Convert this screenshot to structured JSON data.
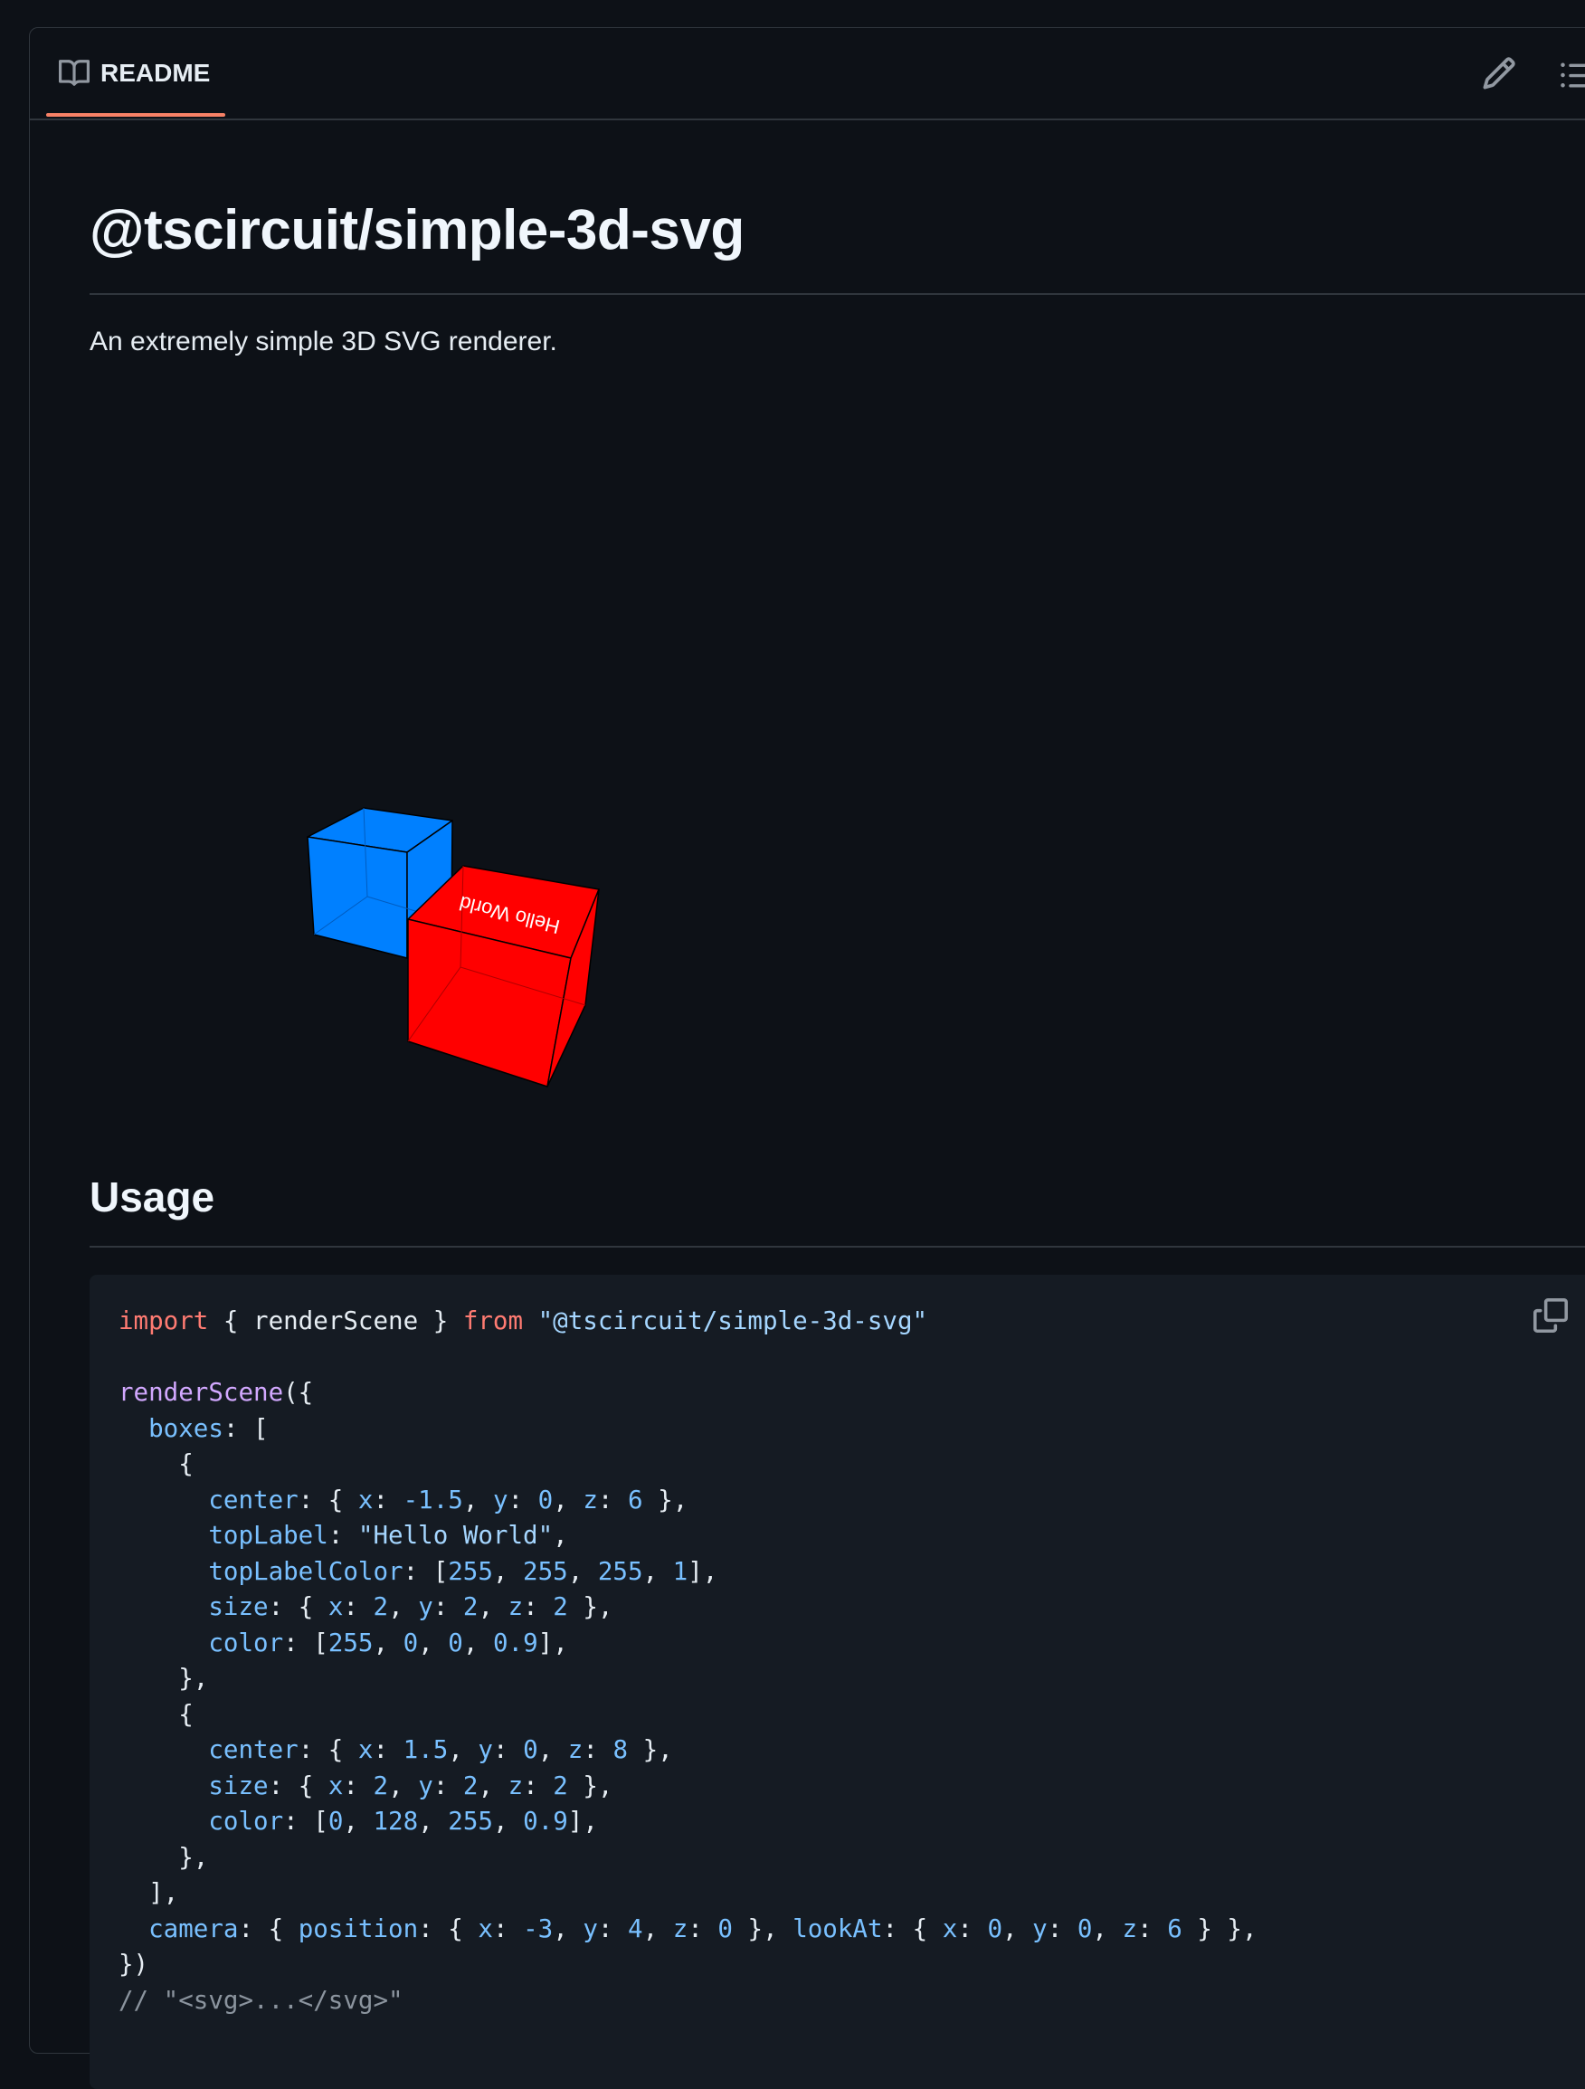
{
  "tab": {
    "label": "README",
    "icon": "book-icon"
  },
  "toolbar": {
    "edit_icon": "pencil-icon",
    "outline_icon": "list-icon",
    "copy_icon": "copy-icon"
  },
  "readme": {
    "title": "@tscircuit/simple-3d-svg",
    "description": "An extremely simple 3D SVG renderer.",
    "usage_heading": "Usage"
  },
  "scene": {
    "label_text": "Hello World",
    "blue_color": "#0080ff",
    "red_color": "#ff0000"
  },
  "code": {
    "l1": {
      "kw1": "import",
      "p1": " { renderScene } ",
      "kw2": "from",
      "p2": " ",
      "str": "\"@tscircuit/simple-3d-svg\""
    },
    "l3": {
      "fn": "renderScene",
      "p1": "({"
    },
    "l4": {
      "p0": "  ",
      "prop": "boxes",
      "p1": ": ["
    },
    "l5": {
      "p0": "    {"
    },
    "l6": {
      "p0": "      ",
      "prop": "center",
      "p1": ": { ",
      "k1": "x",
      "p2": ": ",
      "v1": "-1.5",
      "p3": ", ",
      "k2": "y",
      "p4": ": ",
      "v2": "0",
      "p5": ", ",
      "k3": "z",
      "p6": ": ",
      "v3": "6",
      "p7": " },"
    },
    "l7": {
      "p0": "      ",
      "prop": "topLabel",
      "p1": ": ",
      "str": "\"Hello World\"",
      "p2": ","
    },
    "l8": {
      "p0": "      ",
      "prop": "topLabelColor",
      "p1": ": [",
      "v1": "255",
      "p2": ", ",
      "v2": "255",
      "p3": ", ",
      "v3": "255",
      "p4": ", ",
      "v4": "1",
      "p5": "],"
    },
    "l9": {
      "p0": "      ",
      "prop": "size",
      "p1": ": { ",
      "k1": "x",
      "p2": ": ",
      "v1": "2",
      "p3": ", ",
      "k2": "y",
      "p4": ": ",
      "v2": "2",
      "p5": ", ",
      "k3": "z",
      "p6": ": ",
      "v3": "2",
      "p7": " },"
    },
    "l10": {
      "p0": "      ",
      "prop": "color",
      "p1": ": [",
      "v1": "255",
      "p2": ", ",
      "v2": "0",
      "p3": ", ",
      "v3": "0",
      "p4": ", ",
      "v4": "0.9",
      "p5": "],"
    },
    "l11": {
      "p0": "    },"
    },
    "l12": {
      "p0": "    {"
    },
    "l13": {
      "p0": "      ",
      "prop": "center",
      "p1": ": { ",
      "k1": "x",
      "p2": ": ",
      "v1": "1.5",
      "p3": ", ",
      "k2": "y",
      "p4": ": ",
      "v2": "0",
      "p5": ", ",
      "k3": "z",
      "p6": ": ",
      "v3": "8",
      "p7": " },"
    },
    "l14": {
      "p0": "      ",
      "prop": "size",
      "p1": ": { ",
      "k1": "x",
      "p2": ": ",
      "v1": "2",
      "p3": ", ",
      "k2": "y",
      "p4": ": ",
      "v2": "2",
      "p5": ", ",
      "k3": "z",
      "p6": ": ",
      "v3": "2",
      "p7": " },"
    },
    "l15": {
      "p0": "      ",
      "prop": "color",
      "p1": ": [",
      "v1": "0",
      "p2": ", ",
      "v2": "128",
      "p3": ", ",
      "v3": "255",
      "p4": ", ",
      "v4": "0.9",
      "p5": "],"
    },
    "l16": {
      "p0": "    },"
    },
    "l17": {
      "p0": "  ],"
    },
    "l18": {
      "p0": "  ",
      "prop": "camera",
      "p1": ": { ",
      "prop2": "position",
      "p2": ": { ",
      "k1": "x",
      "p3": ": ",
      "v1": "-3",
      "p4": ", ",
      "k2": "y",
      "p5": ": ",
      "v2": "4",
      "p6": ", ",
      "k3": "z",
      "p7": ": ",
      "v3": "0",
      "p8": " }, ",
      "prop3": "lookAt",
      "p9": ": { ",
      "k4": "x",
      "p10": ": ",
      "v4": "0",
      "p11": ", ",
      "k5": "y",
      "p12": ": ",
      "v5": "0",
      "p13": ", ",
      "k6": "z",
      "p14": ": ",
      "v6": "6",
      "p15": " } },"
    },
    "l19": {
      "p0": "})"
    },
    "l20": {
      "cm": "// \"<svg>...</svg>\""
    }
  }
}
